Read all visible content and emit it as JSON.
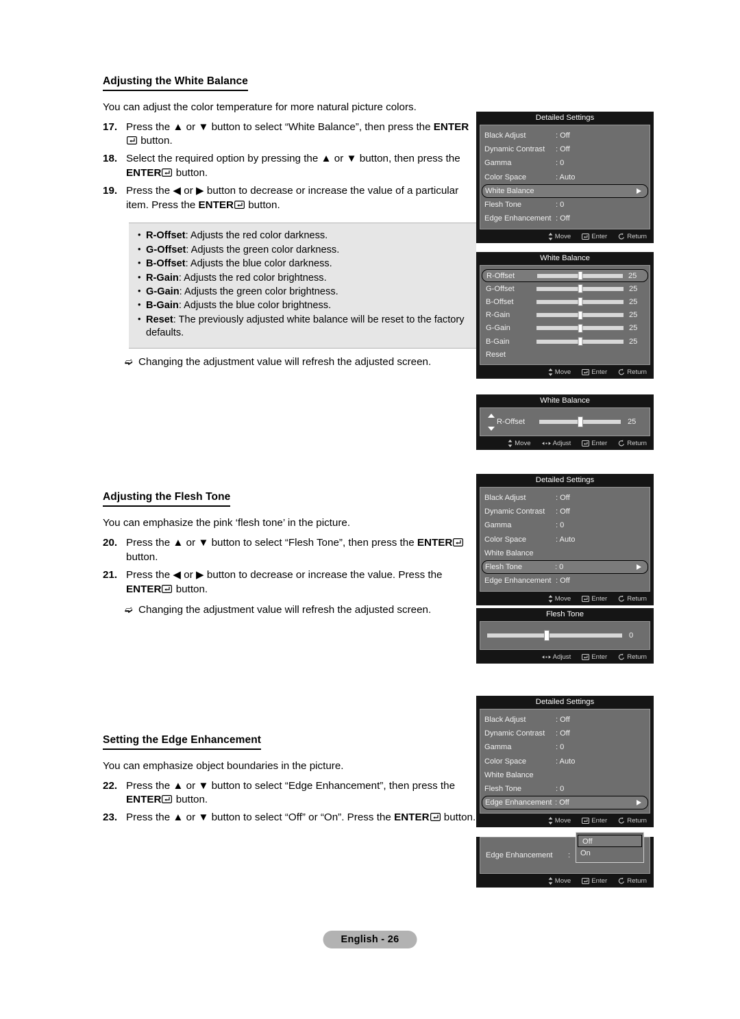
{
  "page": {
    "footer_label": "English - 26"
  },
  "sections": [
    {
      "heading": "Adjusting the White Balance",
      "lead": "You can adjust the color temperature for more natural picture colors.",
      "steps": [
        {
          "num": "17.",
          "text_a": "Press the ▲ or ▼ button to select “White Balance”, then press the ",
          "bold_a": "ENTER",
          "text_b": " button."
        },
        {
          "num": "18.",
          "text_a": "Select the required option by pressing the ▲ or ▼ button, then press the ",
          "bold_a": "ENTER",
          "text_b": " button."
        },
        {
          "num": "19.",
          "text_a": "Press the ◀ or ▶ button to decrease or increase the value of a particular item. Press the ",
          "bold_a": "ENTER",
          "text_b": " button."
        }
      ],
      "callout": [
        {
          "term": "R-Offset",
          "desc": ": Adjusts the red color darkness."
        },
        {
          "term": "G-Offset",
          "desc": ": Adjusts the green color darkness."
        },
        {
          "term": "B-Offset",
          "desc": ": Adjusts the blue color darkness."
        },
        {
          "term": "R-Gain",
          "desc": ": Adjusts the red color brightness."
        },
        {
          "term": "G-Gain",
          "desc": ": Adjusts the green color brightness."
        },
        {
          "term": "B-Gain",
          "desc": ": Adjusts the blue color brightness."
        },
        {
          "term": "Reset",
          "desc": ": The previously adjusted white balance will be reset to the factory defaults."
        }
      ],
      "note": "Changing the adjustment value will refresh the adjusted screen."
    },
    {
      "heading": "Adjusting the Flesh Tone",
      "lead": "You can emphasize the pink ‘flesh tone’ in the picture.",
      "steps": [
        {
          "num": "20.",
          "text_a": "Press the ▲ or ▼ button to select “Flesh Tone”, then press the ",
          "bold_a": "ENTER",
          "text_b": " button."
        },
        {
          "num": "21.",
          "text_a": "Press the ◀ or ▶ button to decrease or increase the value. Press the ",
          "bold_a": "ENTER",
          "text_b": " button."
        }
      ],
      "note": "Changing the adjustment value will refresh the adjusted screen."
    },
    {
      "heading": "Setting the Edge Enhancement",
      "lead": "You can emphasize object boundaries in the picture.",
      "steps": [
        {
          "num": "22.",
          "text_a": "Press the ▲ or ▼ button to select “Edge Enhancement”, then press the ",
          "bold_a": "ENTER",
          "text_b": " button."
        },
        {
          "num": "23.",
          "text_a": "Press the ▲ or ▼ button to select “Off” or “On”. Press the ",
          "bold_a": "ENTER",
          "text_b": " button."
        }
      ]
    }
  ],
  "osd": {
    "footer_move": "Move",
    "footer_adjust": "Adjust",
    "footer_enter": "Enter",
    "footer_return": "Return",
    "detailed_1": {
      "title": "Detailed Settings",
      "rows": [
        {
          "label": "Black Adjust",
          "value": ": Off"
        },
        {
          "label": "Dynamic Contrast",
          "value": ": Off"
        },
        {
          "label": "Gamma",
          "value": ": 0"
        },
        {
          "label": "Color Space",
          "value": ": Auto"
        },
        {
          "label": "White Balance",
          "value": ""
        },
        {
          "label": "Flesh Tone",
          "value": ": 0"
        },
        {
          "label": "Edge Enhancement",
          "value": ": Off"
        }
      ],
      "selected_index": 4
    },
    "white_balance_list": {
      "title": "White Balance",
      "rows": [
        {
          "label": "R-Offset",
          "value": "25"
        },
        {
          "label": "G-Offset",
          "value": "25"
        },
        {
          "label": "B-Offset",
          "value": "25"
        },
        {
          "label": "R-Gain",
          "value": "25"
        },
        {
          "label": "G-Gain",
          "value": "25"
        },
        {
          "label": "B-Gain",
          "value": "25"
        }
      ],
      "reset_label": "Reset",
      "selected_index": 0
    },
    "white_balance_single": {
      "title": "White Balance",
      "label": "R-Offset",
      "value": "25"
    },
    "detailed_2": {
      "title": "Detailed Settings",
      "rows": [
        {
          "label": "Black Adjust",
          "value": ": Off"
        },
        {
          "label": "Dynamic Contrast",
          "value": ": Off"
        },
        {
          "label": "Gamma",
          "value": ": 0"
        },
        {
          "label": "Color Space",
          "value": ": Auto"
        },
        {
          "label": "White Balance",
          "value": ""
        },
        {
          "label": "Flesh Tone",
          "value": ": 0"
        },
        {
          "label": "Edge Enhancement",
          "value": ": Off"
        }
      ],
      "selected_index": 5
    },
    "flesh_tone": {
      "title": "Flesh Tone",
      "value": "0"
    },
    "detailed_3": {
      "title": "Detailed Settings",
      "rows": [
        {
          "label": "Black Adjust",
          "value": ": Off"
        },
        {
          "label": "Dynamic Contrast",
          "value": ": Off"
        },
        {
          "label": "Gamma",
          "value": ": 0"
        },
        {
          "label": "Color Space",
          "value": ": Auto"
        },
        {
          "label": "White Balance",
          "value": ""
        },
        {
          "label": "Flesh Tone",
          "value": ": 0"
        },
        {
          "label": "Edge Enhancement",
          "value": ": Off"
        }
      ],
      "selected_index": 6
    },
    "edge_dropdown": {
      "label": "Edge Enhancement",
      "colon": ":",
      "options": [
        "Off",
        "On"
      ],
      "selected_index": 0
    }
  }
}
